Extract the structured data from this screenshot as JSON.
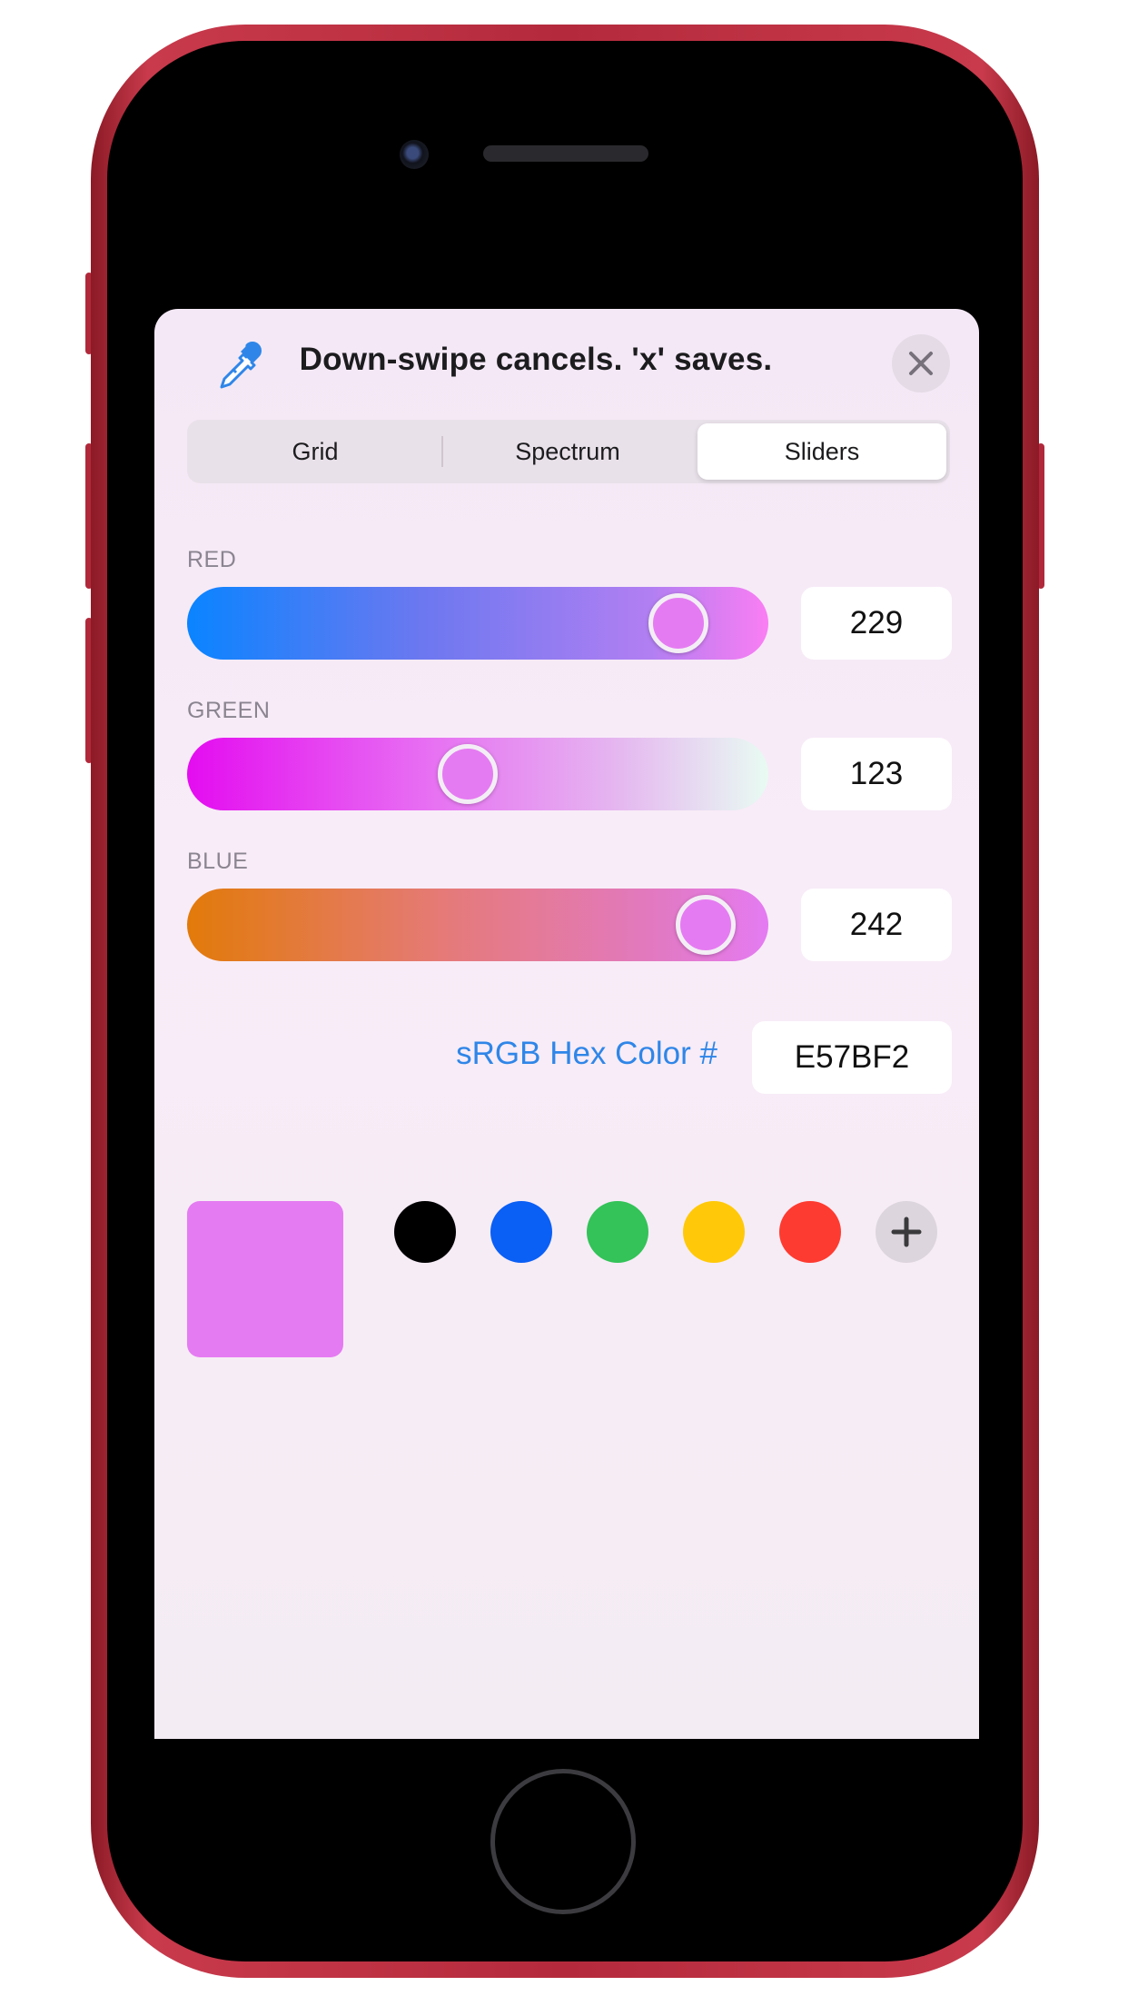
{
  "header": {
    "title": "Down-swipe cancels. 'x' saves.",
    "eyedropper_icon": "eyedropper-icon",
    "close_icon": "close-icon"
  },
  "tabs": [
    {
      "label": "Grid",
      "selected": false
    },
    {
      "label": "Spectrum",
      "selected": false
    },
    {
      "label": "Sliders",
      "selected": true
    }
  ],
  "sliders": {
    "red": {
      "label": "RED",
      "value": "229"
    },
    "green": {
      "label": "GREEN",
      "value": "123"
    },
    "blue": {
      "label": "BLUE",
      "value": "242"
    }
  },
  "hex": {
    "label": "sRGB Hex Color #",
    "value": "E57BF2"
  },
  "current_color": "#e57bf2",
  "swatches": [
    "#000000",
    "#0a5ff5",
    "#33c358",
    "#ffc909",
    "#fe3b30"
  ],
  "add_swatch_icon": "plus-icon"
}
